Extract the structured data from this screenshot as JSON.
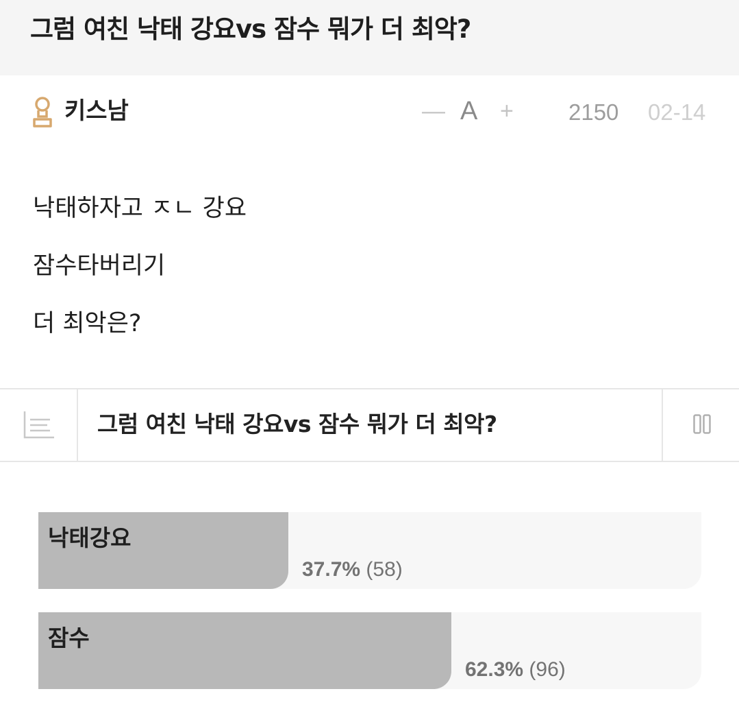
{
  "post": {
    "title": "그럼 여친 낙태 강요vs 잠수 뭐가 더 최악?",
    "author": "키스남",
    "font_controls": {
      "decrease": "—",
      "size": "A",
      "increase": "+"
    },
    "views": "2150",
    "date": "02-14",
    "body_lines": [
      "낙태하자고 ㅈㄴ 강요",
      "잠수타버리기",
      "더 최악은?"
    ]
  },
  "poll": {
    "title": "그럼 여친 낙태 강요vs 잠수 뭐가 더 최악?",
    "options": [
      {
        "label": "낙태강요",
        "percent_text": "37.7%",
        "count_text": "(58)",
        "fraction": 0.377
      },
      {
        "label": "잠수",
        "percent_text": "62.3%",
        "count_text": "(96)",
        "fraction": 0.623
      }
    ]
  },
  "colors": {
    "title_bg": "#f5f5f5",
    "author_icon": "#d7a86e",
    "poll_fill": "#b8b8b8",
    "poll_track": "#f7f7f7"
  },
  "icons": {
    "author": "user-rank-icon",
    "poll_list": "list-icon",
    "poll_toggle": "columns-icon"
  }
}
